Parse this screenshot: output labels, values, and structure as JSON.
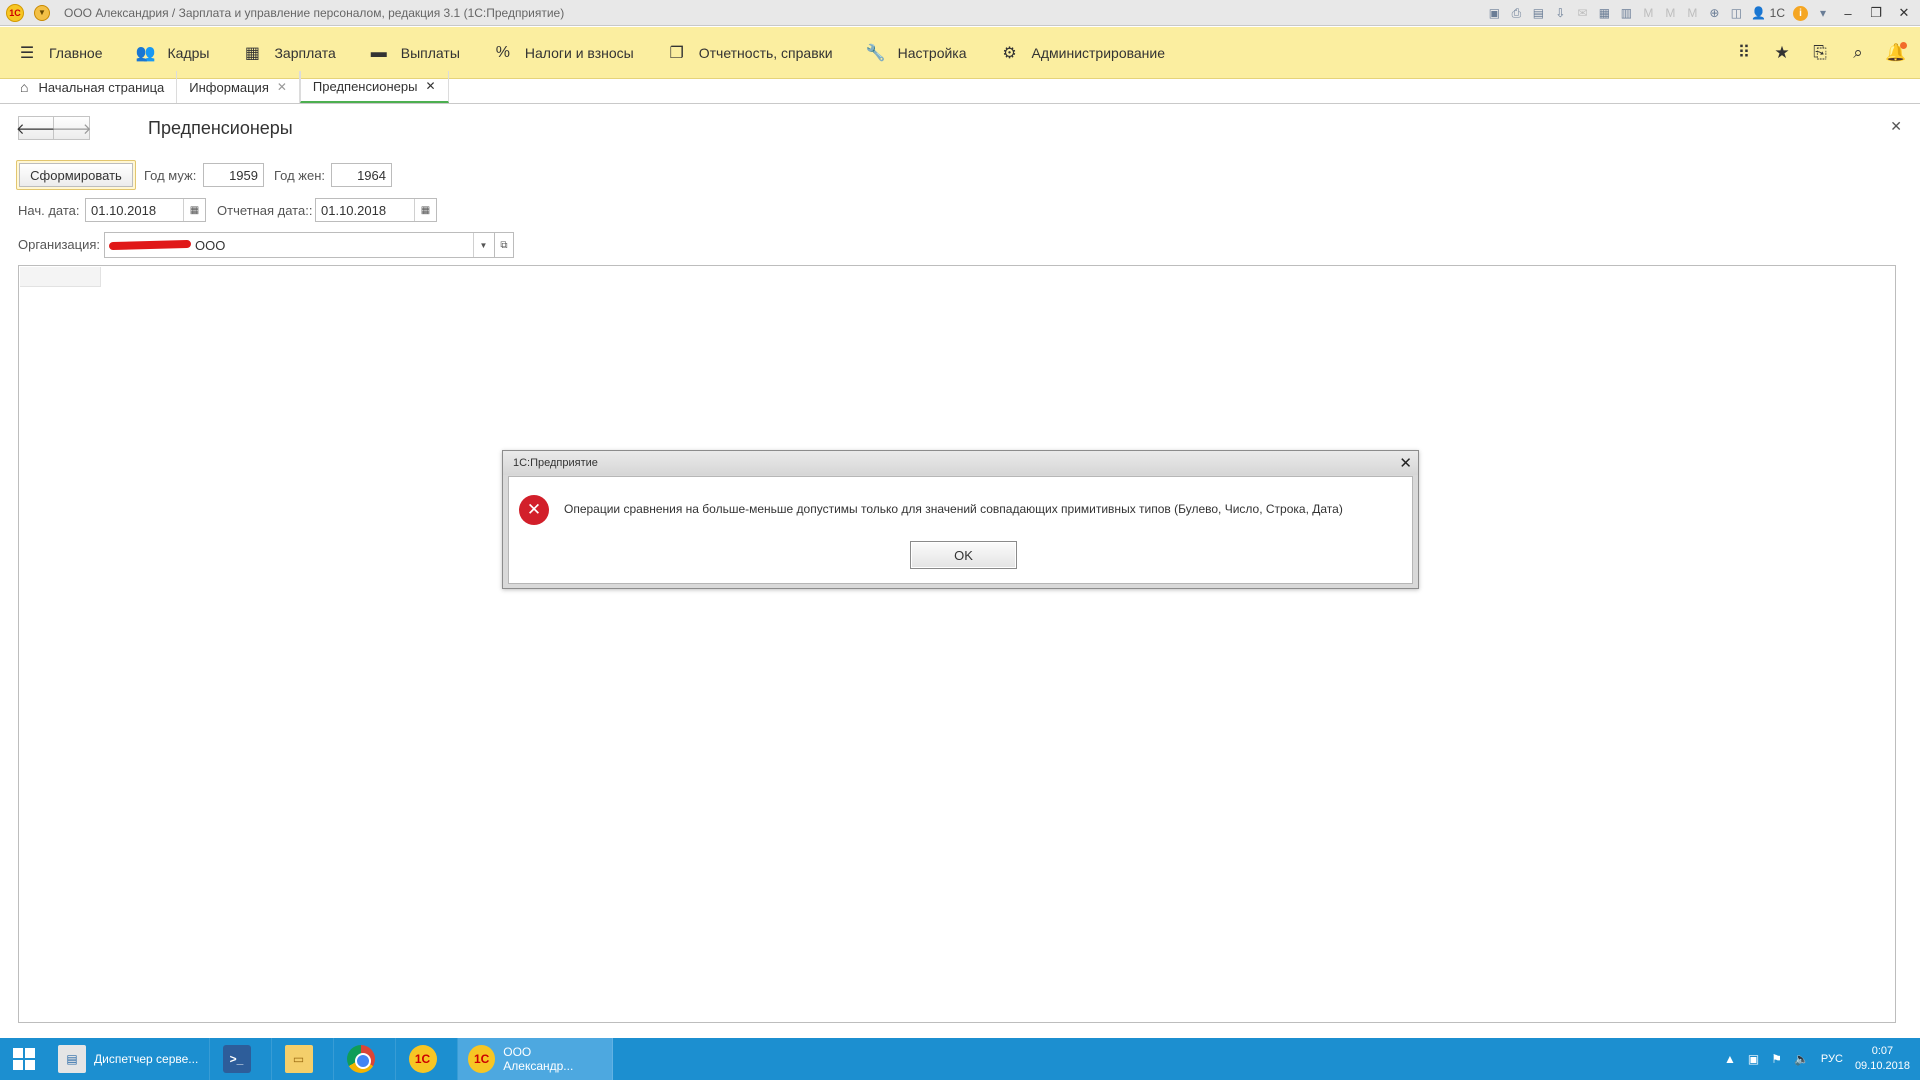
{
  "window": {
    "title": "ООО Александрия / Зарплата и управление персоналом, редакция 3.1  (1С:Предприятие)",
    "user": "1С",
    "logo_text": "1С",
    "info_symbol": "i"
  },
  "sections": {
    "items": [
      {
        "label": "Главное",
        "icon": "menu-icon"
      },
      {
        "label": "Кадры",
        "icon": "people-icon"
      },
      {
        "label": "Зарплата",
        "icon": "calculator-icon"
      },
      {
        "label": "Выплаты",
        "icon": "wallet-icon"
      },
      {
        "label": "Налоги и взносы",
        "icon": "percent-icon"
      },
      {
        "label": "Отчетность, справки",
        "icon": "documents-icon"
      },
      {
        "label": "Настройка",
        "icon": "wrench-icon"
      },
      {
        "label": "Администрирование",
        "icon": "gear-icon"
      }
    ],
    "percent_symbol": "%"
  },
  "tabs": [
    {
      "label": "Начальная страница",
      "active": false,
      "closable": false
    },
    {
      "label": "Информация",
      "active": false,
      "closable": true
    },
    {
      "label": "Предпенсионеры",
      "active": true,
      "closable": true
    }
  ],
  "form": {
    "title": "Предпенсионеры",
    "generate_button": "Сформировать",
    "year_male_label": "Год муж:",
    "year_male_value": "1959",
    "year_female_label": "Год жен:",
    "year_female_value": "1964",
    "start_date_label": "Нач. дата:",
    "start_date_value": "01.10.2018",
    "report_date_label": "Отчетная дата::",
    "report_date_value": "01.10.2018",
    "org_label": "Организация:",
    "org_value": "ООО"
  },
  "dialog": {
    "title": "1С:Предприятие",
    "message": "Операции сравнения на больше-меньше допустимы только для значений совпадающих примитивных типов (Булево, Число, Строка, Дата)",
    "ok_label": "OK",
    "error_symbol": "✕"
  },
  "taskbar": {
    "tasks": [
      {
        "label": "Диспетчер серве...",
        "icon": "server-manager-icon"
      },
      {
        "label": "",
        "icon": "powershell-icon"
      },
      {
        "label": "",
        "icon": "folder-icon"
      },
      {
        "label": "",
        "icon": "chrome-icon"
      },
      {
        "label": "",
        "icon": "1c-icon"
      },
      {
        "label": "ООО Александр...",
        "icon": "1c-icon",
        "active": true
      }
    ],
    "lang": "РУС",
    "time": "0:07",
    "date": "09.10.2018"
  },
  "colors": {
    "sections_bg": "#fbeea0",
    "taskbar_bg": "#1c8fd0",
    "error_red": "#d21f2a",
    "active_tab_underline": "#4caf50"
  }
}
